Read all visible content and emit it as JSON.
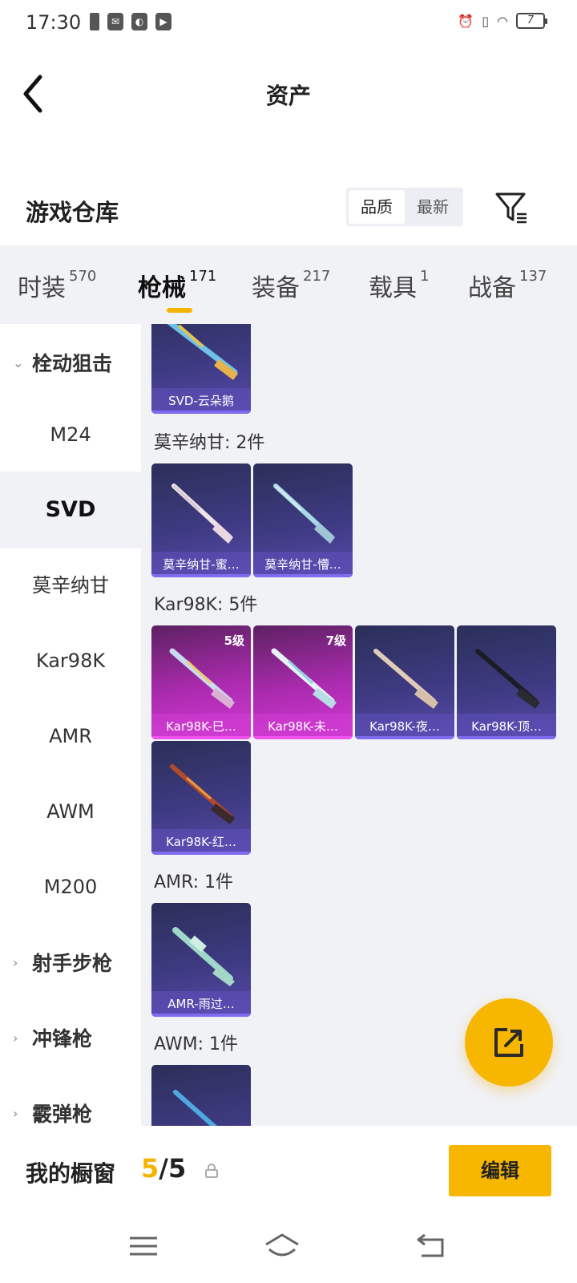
{
  "status_bar": {
    "time": "17:30",
    "battery": "7"
  },
  "header": {
    "title": "资产"
  },
  "section": {
    "title": "游戏仓库",
    "sort_options": [
      "品质",
      "最新"
    ],
    "active_sort": "品质"
  },
  "tabs": [
    {
      "label": "时装",
      "count": "570"
    },
    {
      "label": "枪械",
      "count": "171"
    },
    {
      "label": "装备",
      "count": "217"
    },
    {
      "label": "载具",
      "count": "1"
    },
    {
      "label": "战备",
      "count": "137"
    }
  ],
  "active_tab": "枪械",
  "sidebar": {
    "groups": {
      "bolt": "栓动狙击",
      "marksman": "射手步枪",
      "smg": "冲锋枪",
      "cut": "霰弹枪"
    },
    "items": [
      "M24",
      "SVD",
      "莫辛纳甘",
      "Kar98K",
      "AMR",
      "AWM",
      "M200"
    ],
    "active_item": "SVD"
  },
  "content": {
    "svd_cards": [
      {
        "caption": "SVD-云朵鹅",
        "tint": "purple"
      }
    ],
    "mosin_label": "莫辛纳甘: 2件",
    "mosin_cards": [
      {
        "caption": "莫辛纳甘-蜜…",
        "tint": "purple"
      },
      {
        "caption": "莫辛纳甘-懵…",
        "tint": "purple"
      }
    ],
    "kar_label": "Kar98K: 5件",
    "kar_cards": [
      {
        "caption": "Kar98K-巳…",
        "level": "5级",
        "tint": "pink"
      },
      {
        "caption": "Kar98K-未…",
        "level": "7级",
        "tint": "pink"
      },
      {
        "caption": "Kar98K-夜…",
        "tint": "purple"
      },
      {
        "caption": "Kar98K-顶…",
        "tint": "purple"
      },
      {
        "caption": "Kar98K-红…",
        "tint": "purple"
      }
    ],
    "amr_label": "AMR: 1件",
    "amr_cards": [
      {
        "caption": "AMR-雨过…",
        "tint": "purple"
      }
    ],
    "awm_label": "AWM: 1件"
  },
  "bottom": {
    "showcase_label": "我的橱窗",
    "showcase_current": "5",
    "showcase_sep": "/5",
    "edit_label": "编辑"
  },
  "icons": {
    "accent": "#F7B600",
    "card_purple": "#3E3A82",
    "card_pink": "#AC2BB0"
  }
}
